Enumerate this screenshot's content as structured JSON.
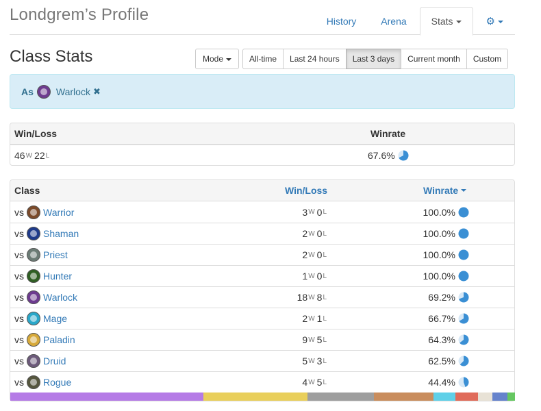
{
  "header": {
    "title": "Londgrem’s Profile",
    "tabs": [
      {
        "label": "History",
        "active": false
      },
      {
        "label": "Arena",
        "active": false
      },
      {
        "label": "Stats",
        "active": true
      },
      {
        "label": "⚙",
        "active": false
      }
    ]
  },
  "section": {
    "title": "Class Stats",
    "mode_label": "Mode",
    "ranges": [
      {
        "label": "All-time",
        "active": false
      },
      {
        "label": "Last 24 hours",
        "active": false
      },
      {
        "label": "Last 3 days",
        "active": true
      },
      {
        "label": "Current month",
        "active": false
      },
      {
        "label": "Custom",
        "active": false
      }
    ]
  },
  "filter": {
    "prefix": "As",
    "class_name": "Warlock",
    "class_icon": "warlock-icon",
    "remove_icon": "✖"
  },
  "summary": {
    "headers": {
      "winloss": "Win/Loss",
      "winrate": "Winrate"
    },
    "wins": "46",
    "losses": "22",
    "w_suffix": "W",
    "l_suffix": "L",
    "winrate": "67.6%",
    "winrate_value": 0.676
  },
  "classes": {
    "headers": {
      "class": "Class",
      "winloss": "Win/Loss",
      "winrate": "Winrate"
    },
    "vs_label": "vs",
    "rows": [
      {
        "name": "Warrior",
        "icon": "warrior-icon",
        "color": "#7a4a2a",
        "wins": "3",
        "losses": "0",
        "winrate": "100.0%",
        "rate": 1.0
      },
      {
        "name": "Shaman",
        "icon": "shaman-icon",
        "color": "#1f3b8a",
        "wins": "2",
        "losses": "0",
        "winrate": "100.0%",
        "rate": 1.0
      },
      {
        "name": "Priest",
        "icon": "priest-icon",
        "color": "#6b7b75",
        "wins": "2",
        "losses": "0",
        "winrate": "100.0%",
        "rate": 1.0
      },
      {
        "name": "Hunter",
        "icon": "hunter-icon",
        "color": "#2f5e23",
        "wins": "1",
        "losses": "0",
        "winrate": "100.0%",
        "rate": 1.0
      },
      {
        "name": "Warlock",
        "icon": "warlock-icon",
        "color": "#6d3b8f",
        "wins": "18",
        "losses": "8",
        "winrate": "69.2%",
        "rate": 0.692
      },
      {
        "name": "Mage",
        "icon": "mage-icon",
        "color": "#2aa7c9",
        "wins": "2",
        "losses": "1",
        "winrate": "66.7%",
        "rate": 0.667
      },
      {
        "name": "Paladin",
        "icon": "paladin-icon",
        "color": "#d6a93a",
        "wins": "9",
        "losses": "5",
        "winrate": "64.3%",
        "rate": 0.643
      },
      {
        "name": "Druid",
        "icon": "druid-icon",
        "color": "#6c5a7a",
        "wins": "5",
        "losses": "3",
        "winrate": "62.5%",
        "rate": 0.625
      },
      {
        "name": "Rogue",
        "icon": "rogue-icon",
        "color": "#55563e",
        "wins": "4",
        "losses": "5",
        "winrate": "44.4%",
        "rate": 0.444
      }
    ]
  },
  "distribution": [
    {
      "class": "Warlock",
      "color": "#b57be6",
      "share": 26
    },
    {
      "class": "Paladin",
      "color": "#e9cf5b",
      "share": 14
    },
    {
      "class": "Priest",
      "color": "#9e9e9e",
      "share": 9
    },
    {
      "class": "Warrior",
      "color": "#c98d5d",
      "share": 8
    },
    {
      "class": "Mage",
      "color": "#5fd0e8",
      "share": 3
    },
    {
      "class": "Hunter",
      "color": "#e06b5a",
      "share": 3
    },
    {
      "class": "Rogue",
      "color": "#e8e2d6",
      "share": 2
    },
    {
      "class": "Shaman",
      "color": "#6683cc",
      "share": 2
    },
    {
      "class": "Druid",
      "color": "#66c761",
      "share": 1
    }
  ],
  "colors": {
    "link": "#337ab7",
    "pie": "#3a8fd4",
    "alert_bg": "#d9edf7"
  }
}
